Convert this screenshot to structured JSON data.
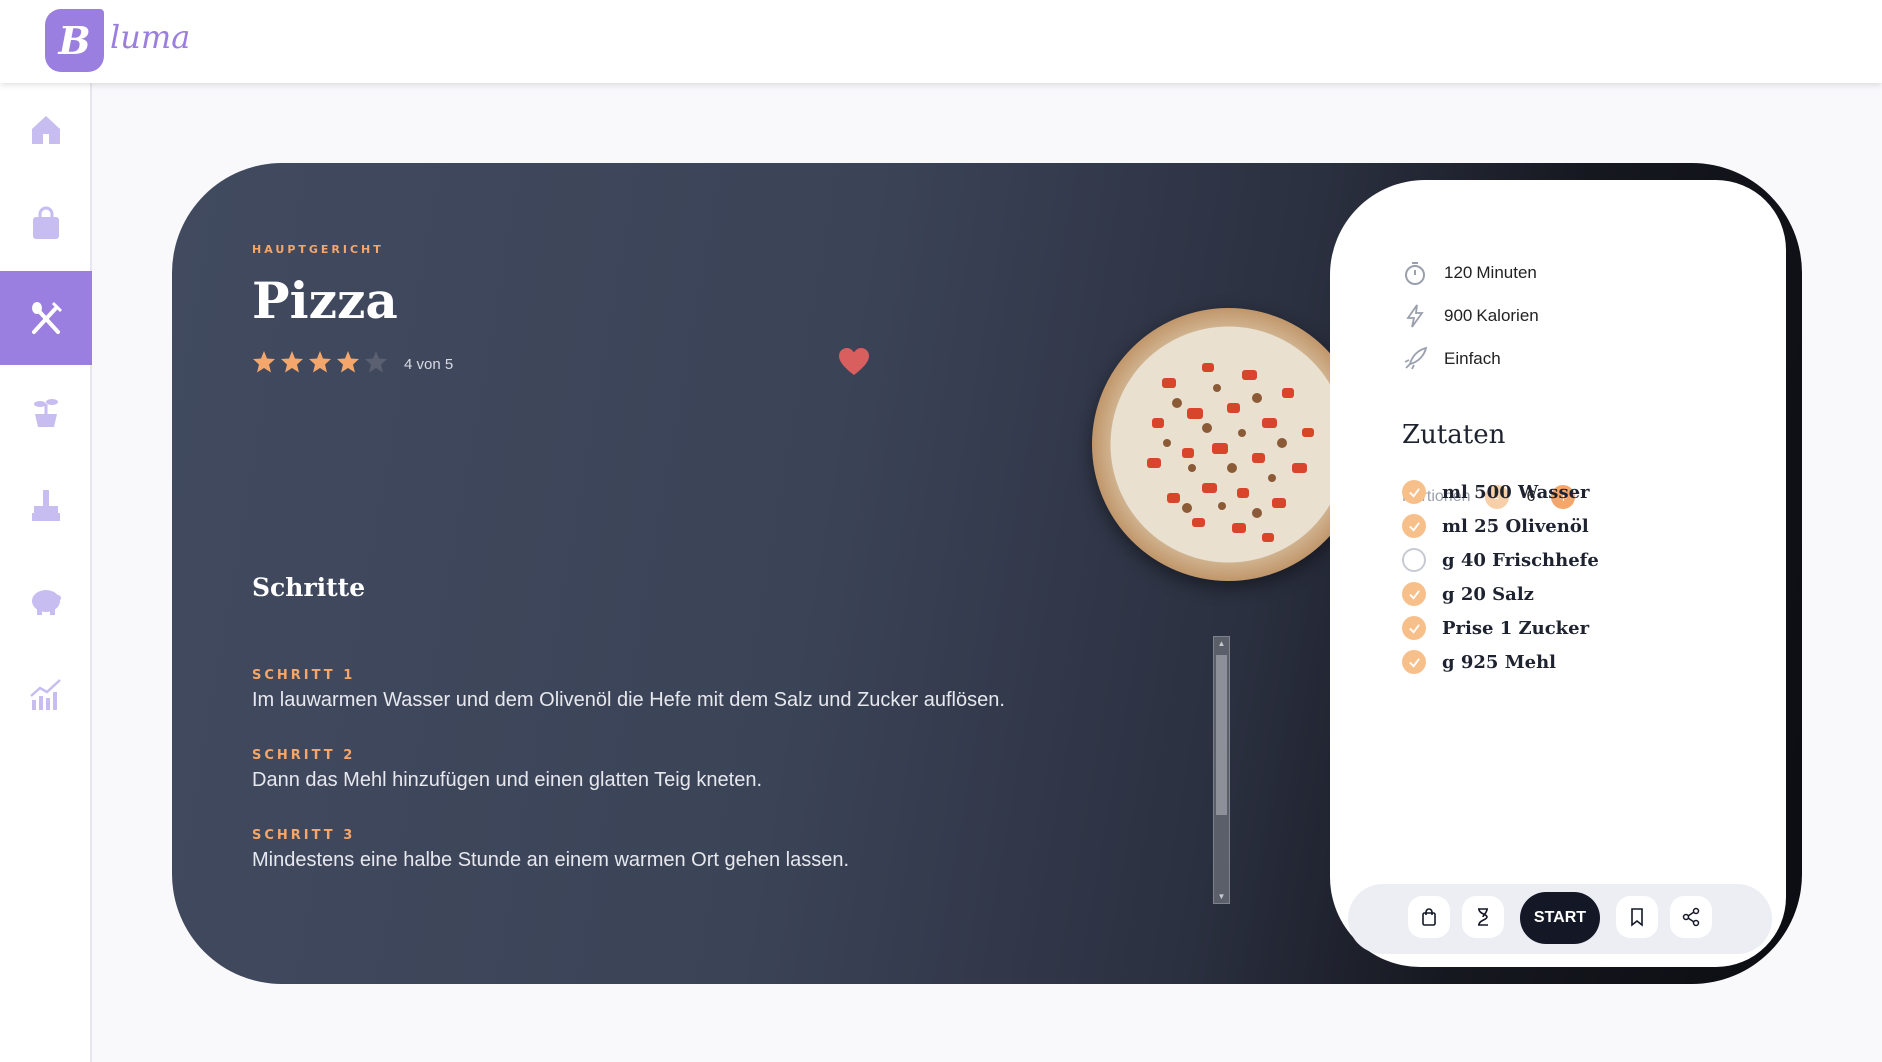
{
  "app": {
    "logo_letter": "B",
    "logo_text": "luma"
  },
  "sidebar": {
    "items": [
      {
        "name": "home",
        "active": false
      },
      {
        "name": "shopping",
        "active": false
      },
      {
        "name": "recipes",
        "active": true
      },
      {
        "name": "plants",
        "active": false
      },
      {
        "name": "cleaning",
        "active": false
      },
      {
        "name": "savings",
        "active": false
      },
      {
        "name": "statistics",
        "active": false
      }
    ]
  },
  "recipe": {
    "category": "HAUPTGERICHT",
    "title": "Pizza",
    "rating": 4,
    "rating_max": 5,
    "rating_text": "4 von 5",
    "favorite": true,
    "steps_heading": "Schritte",
    "steps": [
      {
        "label": "SCHRITT 1",
        "text": "Im lauwarmen Wasser und dem Olivenöl die Hefe mit dem Salz und Zucker auflösen."
      },
      {
        "label": "SCHRITT 2",
        "text": "Dann das Mehl hinzufügen und einen glatten Teig kneten."
      },
      {
        "label": "SCHRITT 3",
        "text": "Mindestens eine halbe Stunde an einem warmen Ort gehen lassen."
      }
    ]
  },
  "details": {
    "time_value": "120",
    "time_unit": "Minuten",
    "calories_value": "900",
    "calories_unit": "Kalorien",
    "difficulty": "Einfach",
    "ingredients_heading": "Zutaten",
    "portions_label": "Portionen",
    "portions_minus": "-",
    "portions_value": "6",
    "portions_plus": "+",
    "ingredients": [
      {
        "text": "ml 500 Wasser",
        "checked": true
      },
      {
        "text": "ml 25 Olivenöl",
        "checked": true
      },
      {
        "text": "g 40 Frischhefe",
        "checked": false
      },
      {
        "text": "g 20 Salz",
        "checked": true
      },
      {
        "text": "Prise 1 Zucker",
        "checked": true
      },
      {
        "text": "g 925 Mehl",
        "checked": true
      }
    ]
  },
  "toolbar": {
    "start_label": "START"
  },
  "colors": {
    "accent": "#9b7fe0",
    "orange": "#f5a66b",
    "dark": "#141826"
  }
}
